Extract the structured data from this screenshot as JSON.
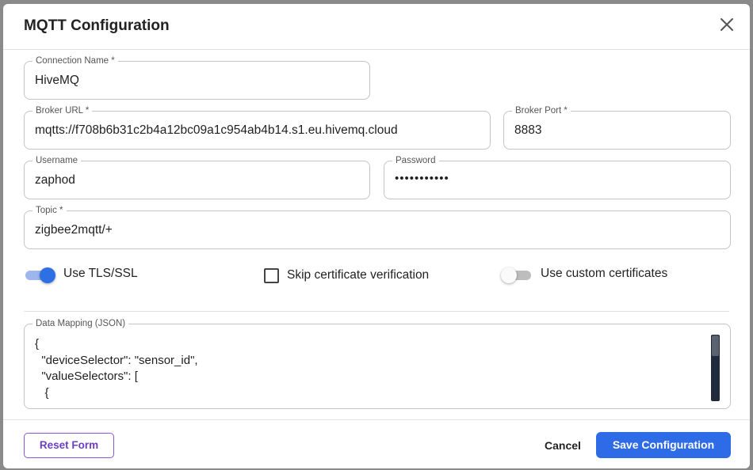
{
  "dialog": {
    "title": "MQTT Configuration",
    "close_icon": "close-icon"
  },
  "fields": {
    "connection_name": {
      "label": "Connection Name *",
      "value": "HiveMQ"
    },
    "broker_url": {
      "label": "Broker URL *",
      "value": "mqtts://f708b6b31c2b4a12bc09a1c954ab4b14.s1.eu.hivemq.cloud"
    },
    "broker_port": {
      "label": "Broker Port *",
      "value": "8883"
    },
    "username": {
      "label": "Username",
      "value": "zaphod"
    },
    "password": {
      "label": "Password",
      "value": "•••••••••••"
    },
    "topic": {
      "label": "Topic *",
      "value": "zigbee2mqtt/+"
    }
  },
  "options": {
    "use_tls": {
      "label": "Use TLS/SSL",
      "checked": true
    },
    "skip_cert": {
      "label": "Skip certificate verification",
      "checked": false
    },
    "custom_certs": {
      "label": "Use custom certificates",
      "checked": false
    }
  },
  "data_mapping": {
    "label": "Data Mapping (JSON)",
    "value": "{\n  \"deviceSelector\": \"sensor_id\",\n  \"valueSelectors\": [\n   {"
  },
  "footer": {
    "reset_label": "Reset Form",
    "cancel_label": "Cancel",
    "save_label": "Save Configuration"
  },
  "colors": {
    "primary": "#2e6be6",
    "reset_accent": "#8a56d6",
    "toggle_on": "#2f6fe4"
  }
}
